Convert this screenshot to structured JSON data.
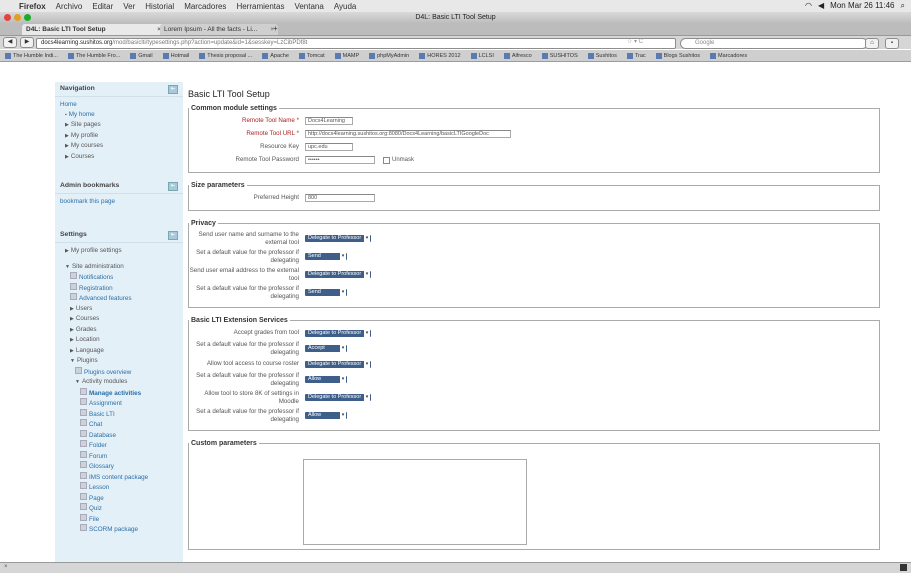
{
  "menubar": {
    "app": "Firefox",
    "items": [
      "Archivo",
      "Editar",
      "Ver",
      "Historial",
      "Marcadores",
      "Herramientas",
      "Ventana",
      "Ayuda"
    ],
    "clock": "Mon Mar 26  11:46"
  },
  "window": {
    "title": "D4L: Basic LTI Tool Setup"
  },
  "tabs": [
    {
      "label": "D4L: Basic LTI Tool Setup"
    },
    {
      "label": "Lorem Ipsum - All the facts - Li..."
    }
  ],
  "navbar": {
    "url_host": "docs4learning.sushitos.org",
    "url_path": "/mod/basiclti/typesettings.php?action=update&id=1&sesskey=LzCibPDf8t",
    "search_placeholder": "Google"
  },
  "bookmarks": [
    "The Humble Indi...",
    "The Humble Fro...",
    "Gmail",
    "Hotmail",
    "Thesis proposal ...",
    "Apache",
    "Tomcat",
    "MAMP",
    "phpMyAdmin",
    "HORES 2012",
    "LCLSI",
    "Alfresco",
    "SUSHITOS",
    "Sushitos",
    "Trac",
    "Blogs Sushitos",
    "Marcadores"
  ],
  "sidebar": {
    "navigation": {
      "title": "Navigation",
      "home": "Home",
      "items": [
        "My home",
        "Site pages",
        "My profile",
        "My courses",
        "Courses"
      ]
    },
    "admin_bookmarks": {
      "title": "Admin bookmarks",
      "link": "bookmark this page"
    },
    "settings": {
      "title": "Settings",
      "my_profile": "My profile settings",
      "site_admin": "Site administration",
      "admin_items": [
        "Notifications",
        "Registration",
        "Advanced features"
      ],
      "admin_sections": [
        "Users",
        "Courses",
        "Grades",
        "Location",
        "Language"
      ],
      "plugins": "Plugins",
      "plugins_overview": "Plugins overview",
      "activity_modules": "Activity modules",
      "manage_activities": "Manage activities",
      "modules": [
        "Assignment",
        "Basic LTI",
        "Chat",
        "Database",
        "Folder",
        "Forum",
        "Glossary",
        "IMS content package",
        "Lesson",
        "Page",
        "Quiz",
        "File",
        "SCORM package"
      ]
    }
  },
  "main": {
    "heading": "Basic LTI Tool Setup",
    "common": {
      "legend": "Common module settings",
      "name_label": "Remote Tool Name",
      "name_value": "Docs4Learning",
      "url_label": "Remote Tool URL",
      "url_value": "http://docs4learning.sushitos.org:8080/Docs4Learning/basicLTIGoogleDoc",
      "key_label": "Resource Key",
      "key_value": "upc.edu",
      "pwd_label": "Remote Tool Password",
      "pwd_value": "••••••",
      "unmask": "Unmask"
    },
    "size": {
      "legend": "Size parameters",
      "height_label": "Preferred Height",
      "height_value": "800"
    },
    "privacy": {
      "legend": "Privacy",
      "rows": [
        {
          "label": "Send user name and surname to the external tool",
          "value": "Delegate to Professor"
        },
        {
          "label": "Set a default value for the professor if delegating",
          "value": "Send"
        },
        {
          "label": "Send user email address to the external tool",
          "value": "Delegate to Professor"
        },
        {
          "label": "Set a default value for the professor if delegating",
          "value": "Send"
        }
      ]
    },
    "extensions": {
      "legend": "Basic LTI Extension Services",
      "rows": [
        {
          "label": "Accept grades from tool",
          "value": "Delegate to Professor"
        },
        {
          "label": "Set a default value for the professor if delegating",
          "value": "Accept"
        },
        {
          "label": "Allow tool access to course roster",
          "value": "Delegate to Professor"
        },
        {
          "label": "Set a default value for the professor if delegating",
          "value": "Allow"
        },
        {
          "label": "Allow tool to store 8K of settings in Moodle",
          "value": "Delegate to Professor"
        },
        {
          "label": "Set a default value for the professor if delegating",
          "value": "Allow"
        }
      ]
    },
    "custom": {
      "legend": "Custom parameters"
    }
  }
}
